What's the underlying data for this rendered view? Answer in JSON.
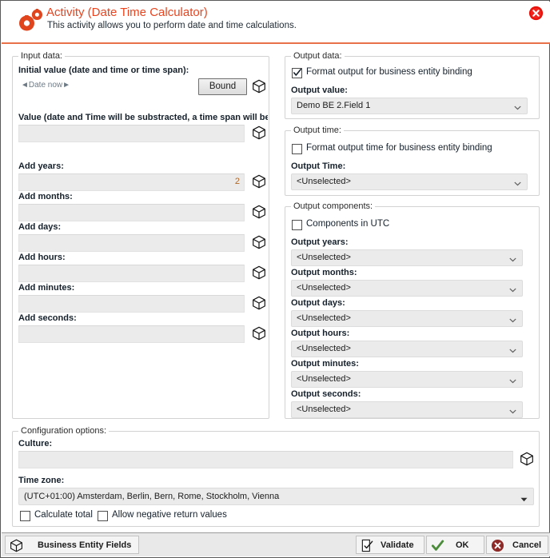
{
  "window": {
    "title": "Activity (Date Time Calculator)",
    "subtitle": "This activity allows you to perform date and time calculations.",
    "close_label": "close-button",
    "accent_color": "#e8441f",
    "separator_color": "#e8714a"
  },
  "input_panel": {
    "legend": "Input data:",
    "initial_value_label": "Initial value (date and time or time span):",
    "date_now_text": "◄Date now►",
    "bound_button": "Bound",
    "value_label": "Value (date and Time will be substracted, a time span will be added",
    "value_field": "",
    "fields": [
      {
        "label": "Add years:",
        "value": "2"
      },
      {
        "label": "Add months:",
        "value": ""
      },
      {
        "label": "Add days:",
        "value": ""
      },
      {
        "label": "Add hours:",
        "value": ""
      },
      {
        "label": "Add minutes:",
        "value": ""
      },
      {
        "label": "Add seconds:",
        "value": ""
      }
    ]
  },
  "output_data": {
    "legend": "Output data:",
    "format_checkbox_label": "Format output for business entity binding",
    "format_checkbox_checked": true,
    "output_value_label": "Output value:",
    "output_value": "Demo BE 2.Field 1"
  },
  "output_time": {
    "legend": "Output time:",
    "format_checkbox_label": "Format output time for business entity binding",
    "format_checkbox_checked": false,
    "output_time_label": "Output Time:",
    "output_time_value": "<Unselected>"
  },
  "output_components": {
    "legend": "Output components:",
    "utc_checkbox_label": "Components in UTC",
    "utc_checkbox_checked": false,
    "rows": [
      {
        "label": "Output years:",
        "value": "<Unselected>"
      },
      {
        "label": "Output months:",
        "value": "<Unselected>"
      },
      {
        "label": "Output days:",
        "value": "<Unselected>"
      },
      {
        "label": "Output hours:",
        "value": "<Unselected>"
      },
      {
        "label": "Output minutes:",
        "value": "<Unselected>"
      },
      {
        "label": "Output seconds:",
        "value": "<Unselected>"
      }
    ]
  },
  "configuration": {
    "legend": "Configuration options:",
    "culture_label": "Culture:",
    "culture_value": "",
    "timezone_label": "Time zone:",
    "timezone_value": "(UTC+01:00) Amsterdam, Berlin, Bern, Rome, Stockholm, Vienna",
    "calculate_total_label": "Calculate total",
    "calculate_total_checked": false,
    "allow_negative_label": "Allow negative return values",
    "allow_negative_checked": false
  },
  "bottom_bar": {
    "business_entity_fields": "Business Entity Fields",
    "validate": "Validate",
    "ok": "OK",
    "cancel": "Cancel"
  }
}
